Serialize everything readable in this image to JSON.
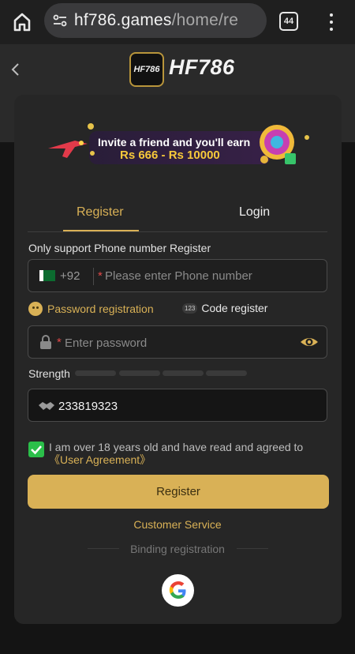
{
  "browser": {
    "url_host": "hf786.games",
    "url_path": "/home/re",
    "tab_count": "44"
  },
  "site": {
    "logo_badge_text": "HF786",
    "logo_text": "HF786"
  },
  "banner": {
    "line1": "Invite a friend and you'll earn",
    "line2": "Rs 666 - Rs 10000"
  },
  "tabs": {
    "register": "Register",
    "login": "Login"
  },
  "form": {
    "phone_note": "Only support Phone number Register",
    "dial_code": "+92",
    "required_mark": "*",
    "phone_placeholder": "Please enter Phone number",
    "option_password": "Password registration",
    "option_code": "Code register",
    "option_code_icon": "123",
    "password_placeholder": "Enter password",
    "strength_label": "Strength",
    "code_value": "233819323",
    "agree_text": "I am over 18 years old and have read and agreed to",
    "agree_link": "《User Agreement》",
    "register_button": "Register",
    "customer_service": "Customer Service",
    "binding_registration": "Binding registration"
  },
  "colors": {
    "accent": "#d9b156",
    "check": "#2bbf4a",
    "required": "#e04848"
  }
}
